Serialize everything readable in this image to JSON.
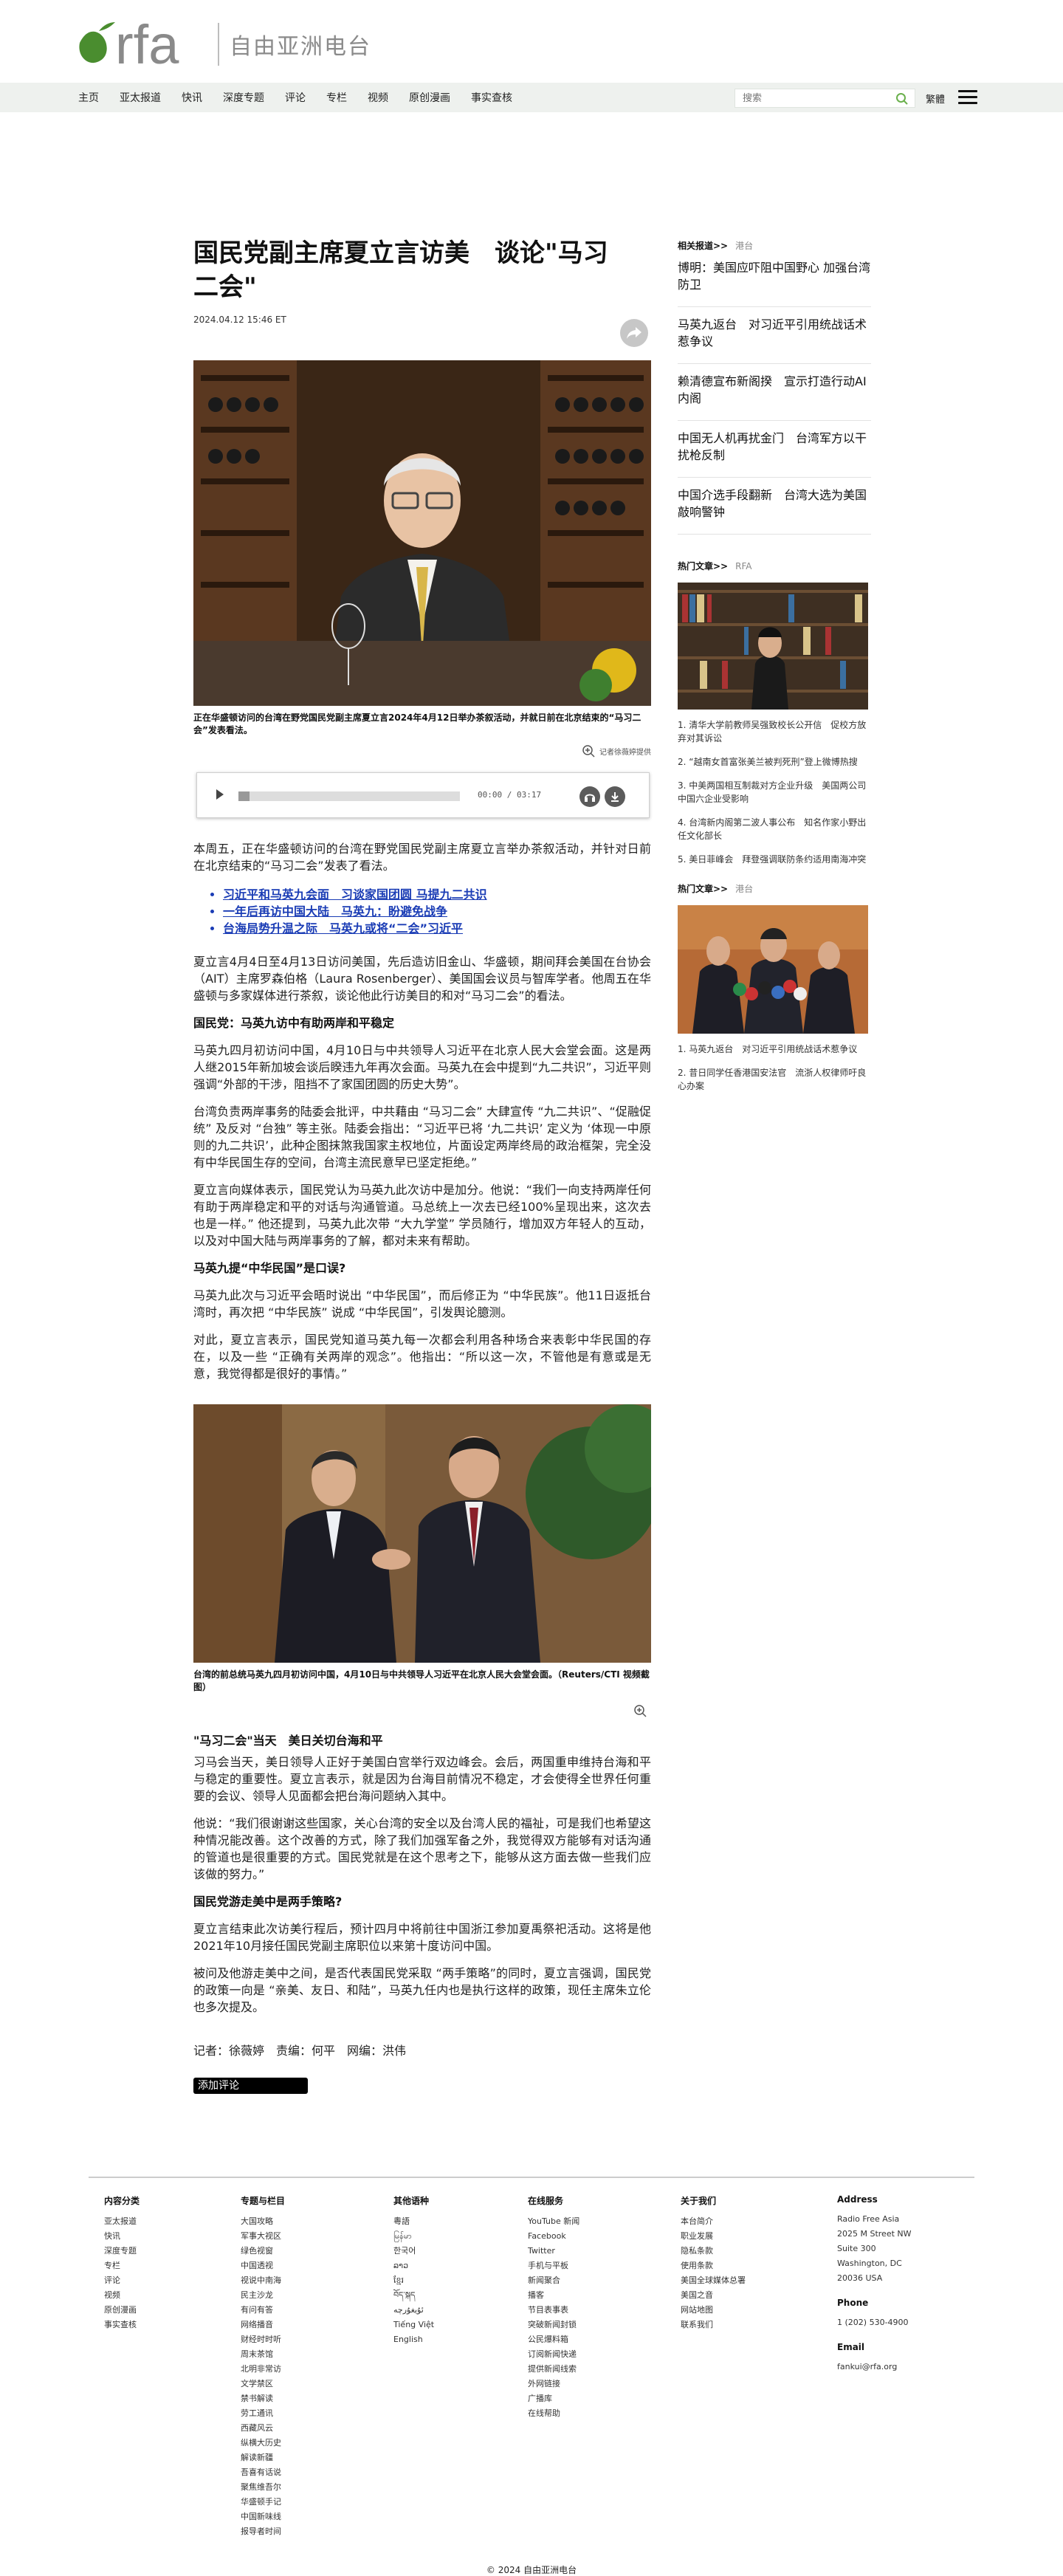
{
  "brand": {
    "wordmark": "rfa",
    "name_cn": "自由亚洲电台",
    "logo_green": "#4a8d2f",
    "logo_grey": "#8a8a8a"
  },
  "nav": {
    "items": [
      "主页",
      "亚太报道",
      "快讯",
      "深度专题",
      "评论",
      "专栏",
      "视频",
      "原创漫画",
      "事实查核"
    ],
    "search_placeholder": "搜索",
    "lang": "繁體"
  },
  "article": {
    "title": "国民党副主席夏立言访美　谈论\"马习二会\"",
    "date": "2024.04.12 15:46 ET",
    "photo1_caption": "正在华盛顿访问的台湾在野党国民党副主席夏立言2024年4月12日举办茶叙活动，并就日前在北京结束的“马习二会”发表看法。",
    "photo1_credit": "记者徐薇婷提供",
    "audio": {
      "time": "00:00 / 03:17",
      "progress": 0.05
    },
    "intro": "本周五，正在华盛顿访问的台湾在野党国民党副主席夏立言举办茶叙活动，并针对日前在北京结束的“马习二会”发表了看法。",
    "related": [
      "习近平和马英九会面　习谈家国团圆 马提九二共识",
      "一年后再访中国大陆　马英九：盼避免战争",
      "台海局势升温之际　马英九或将“二会”习近平"
    ],
    "p1": "夏立言4月4日至4月13日访问美国，先后造访旧金山、华盛顿，期间拜会美国在台协会（AIT）主席罗森伯格（Laura Rosenberger）、美国国会议员与智库学者。他周五在华盛顿与多家媒体进行茶叙，谈论他此行访美目的和对“马习二会”的看法。",
    "h1": "国民党：马英九访中有助两岸和平稳定",
    "p2": "马英九四月初访问中国，4月10日与中共领导人习近平在北京人民大会堂会面。这是两人继2015年新加坡会谈后睽违九年再次会面。马英九在会中提到“九二共识”，习近平则强调“外部的干涉，阻挡不了家国团圆的历史大势”。",
    "p3": "台湾负责两岸事务的陆委会批评，中共藉由 “马习二会” 大肆宣传 “九二共识”、“促融促统” 及反对 “台独” 等主张。陆委会指出：“习近平已将 ‘九二共识’ 定义为 ‘体现一中原则的九二共识’，此种企图抹煞我国家主权地位，片面设定两岸终局的政治框架，完全没有中华民国生存的空间，台湾主流民意早已坚定拒绝。”",
    "p4": "夏立言向媒体表示，国民党认为马英九此次访中是加分。他说：“我们一向支持两岸任何有助于两岸稳定和平的对话与沟通管道。马总统上一次去已经100%呈现出来，这次去也是一样。” 他还提到，马英九此次带 “大九学堂” 学员随行，增加双方年轻人的互动，以及对中国大陆与两岸事务的了解，都对未来有帮助。",
    "h2": "马英九提“中华民国”是口误?",
    "p5": "马英九此次与习近平会晤时说出 “中华民国”，而后修正为 “中华民族”。他11日返抵台湾时，再次把 “中华民族” 说成 “中华民国”，引发舆论臆测。",
    "p6": "对此，夏立言表示，国民党知道马英九每一次都会利用各种场合来表彰中华民国的存在，以及一些 “正确有关两岸的观念”。他指出：“所以这一次，不管他是有意或是无意，我觉得都是很好的事情。”",
    "photo2_caption": "台湾的前总统马英九四月初访问中国，4月10日与中共领导人习近平在北京人民大会堂会面。（Reuters/CTI 视频截图）",
    "h3": "\"马习二会\"当天　美日关切台海和平",
    "p7": "习马会当天，美日领导人正好于美国白宫举行双边峰会。会后，两国重申维持台海和平与稳定的重要性。夏立言表示，就是因为台海目前情况不稳定，才会使得全世界任何重要的会议、领导人见面都会把台海问题纳入其中。",
    "p8": "他说：“我们很谢谢这些国家，关心台湾的安全以及台湾人民的福祉，可是我们也希望这种情况能改善。这个改善的方式，除了我们加强军备之外，我觉得双方能够有对话沟通的管道也是很重要的方式。国民党就是在这个思考之下，能够从这方面去做一些我们应该做的努力。”",
    "h4": "国民党游走美中是两手策略?",
    "p9": "夏立言结束此次访美行程后，预计四月中将前往中国浙江参加夏禹祭祀活动。这将是他2021年10月接任国民党副主席职位以来第十度访问中国。",
    "p10": "被问及他游走美中之间，是否代表国民党采取 “两手策略”的同时，夏立言强调，国民党的政策一向是 “亲美、友日、和陆”，马英九任内也是执行这样的政策，现任主席朱立伦也多次提及。",
    "byline": "记者：徐薇婷　责编：何平　网编：洪伟",
    "comment_btn": "添加评论"
  },
  "sidebar": {
    "related_label": "相关报道>>",
    "related_src": "港台",
    "related": [
      "博明：美国应吓阻中国野心 加强台湾防卫",
      "马英九返台　对习近平引用统战话术惹争议",
      "赖清德宣布新阁揆　宣示打造行动AI内阁",
      "中国无人机再扰金门　台湾军方以干扰枪反制",
      "中国介选手段翻新　台湾大选为美国敲响警钟"
    ],
    "hot1_label": "热门文章>>",
    "hot1_src": "RFA",
    "hot1": [
      "1. 清华大学前教师吴强致校长公开信　促校方放弃对其诉讼",
      "2. “越南女首富张美兰被判死刑”登上微博热搜",
      "3. 中美两国相互制裁对方企业升级　美国两公司中国六企业受影响",
      "4. 台湾新内阁第二波人事公布　知名作家小野出任文化部长",
      "5. 美日菲峰会　拜登强调联防条约适用南海冲突"
    ],
    "hot2_label": "热门文章>>",
    "hot2_src": "港台",
    "hot2": [
      "1. 马英九返台　对习近平引用统战话术惹争议",
      "2. 昔日同学任香港国安法官　流浙人权律师吁良心办案"
    ]
  },
  "footer": {
    "cols": [
      {
        "title": "内容分类",
        "items": [
          "亚太报道",
          "快讯",
          "深度专题",
          "专栏",
          "评论",
          "视频",
          "原创漫画",
          "事实查核"
        ]
      },
      {
        "title": "专题与栏目",
        "items": [
          "大国攻略",
          "军事大视区",
          "绿色视窗",
          "中国透视",
          "视说中南海",
          "民主沙龙",
          "有问有答",
          "网络播音",
          "财经时时听",
          "周末茶馆",
          "北明非常访",
          "文学禁区",
          "禁书解读",
          "劳工通讯",
          "西藏风云",
          "纵横大历史",
          "解读新疆",
          "吾喜有话说",
          "聚焦维吾尔",
          "华盛顿手记",
          "中国新味线",
          "报导者时间"
        ]
      },
      {
        "title": "其他语种",
        "items": [
          "粵語",
          "မြန်မာ",
          "한국어",
          "ລາວ",
          "ខ្មែរ",
          "བོད་སྐད",
          "ئۇيغۇرچە",
          "Tiếng Việt",
          "English"
        ]
      },
      {
        "title": "在线服务",
        "items": [
          "YouTube 新闻",
          "Facebook",
          "Twitter",
          "手机与平板",
          "新闻聚合",
          "播客",
          "节目表事表",
          "突破新闻封锁",
          "公民爆料箱",
          "订阅新闻快递",
          "提供新闻线索",
          "外网链接",
          "广播库",
          "在线帮助"
        ]
      },
      {
        "title": "关于我们",
        "items": [
          "本台简介",
          "职业发展",
          "隐私条款",
          "使用条款",
          "美国全球媒体总署",
          "美国之音",
          "网站地图",
          "联系我们"
        ]
      }
    ],
    "address_title": "Address",
    "address": [
      "Radio Free Asia",
      "2025 M Street NW",
      "Suite 300",
      "Washington, DC",
      "20036 USA"
    ],
    "phone_title": "Phone",
    "phone": "1 (202) 530-4900",
    "email_title": "Email",
    "email": "fankui@rfa.org",
    "copyright": "© 2024 自由亚洲电台"
  }
}
